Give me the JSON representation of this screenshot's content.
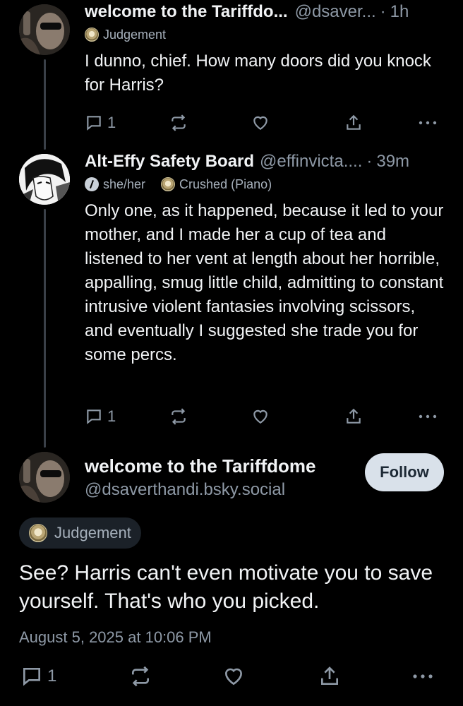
{
  "posts": [
    {
      "name": "welcome to the Tariffdo...",
      "handle": "@dsaver...",
      "time": "1h",
      "labels": [
        {
          "icon": "badge-icon",
          "text": "Judgement"
        }
      ],
      "text": "I dunno, chief. How many doors did you knock for Harris?",
      "replies": "1"
    },
    {
      "name": "Alt-Effy Safety Board",
      "handle": "@effinvicta....",
      "time": "39m",
      "labels": [
        {
          "icon": "pronouns-icon",
          "text": "she/her"
        },
        {
          "icon": "badge-icon",
          "text": "Crushed (Piano)"
        }
      ],
      "text": "Only one, as it happened, because it led to your mother, and I made her a cup of tea and listened to her vent at length about her horrible, appalling, smug little child, admitting to constant intrusive violent fantasies involving scissors, and eventually I suggested she trade you for some percs.",
      "replies": "1"
    }
  ],
  "main_post": {
    "name": "welcome to the Tariffdome",
    "handle": "@dsaverthandi.bsky.social",
    "follow_label": "Follow",
    "label": "Judgement",
    "text": "See? Harris can't even motivate you to save yourself. That's who you picked.",
    "timestamp": "August 5, 2025 at 10:06 PM",
    "replies": "1"
  },
  "colors": {
    "background": "#000000",
    "text": "#f1f3f5",
    "muted": "#8e99a6",
    "follow_bg": "#d9e1ea"
  }
}
